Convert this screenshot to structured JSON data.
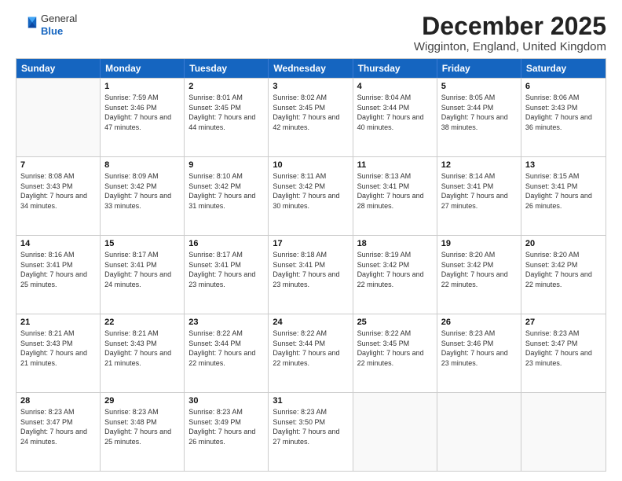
{
  "logo": {
    "line1": "General",
    "line2": "Blue"
  },
  "title": "December 2025",
  "subtitle": "Wigginton, England, United Kingdom",
  "header_days": [
    "Sunday",
    "Monday",
    "Tuesday",
    "Wednesday",
    "Thursday",
    "Friday",
    "Saturday"
  ],
  "weeks": [
    [
      {
        "day": "",
        "sunrise": "",
        "sunset": "",
        "daylight": ""
      },
      {
        "day": "1",
        "sunrise": "Sunrise: 7:59 AM",
        "sunset": "Sunset: 3:46 PM",
        "daylight": "Daylight: 7 hours and 47 minutes."
      },
      {
        "day": "2",
        "sunrise": "Sunrise: 8:01 AM",
        "sunset": "Sunset: 3:45 PM",
        "daylight": "Daylight: 7 hours and 44 minutes."
      },
      {
        "day": "3",
        "sunrise": "Sunrise: 8:02 AM",
        "sunset": "Sunset: 3:45 PM",
        "daylight": "Daylight: 7 hours and 42 minutes."
      },
      {
        "day": "4",
        "sunrise": "Sunrise: 8:04 AM",
        "sunset": "Sunset: 3:44 PM",
        "daylight": "Daylight: 7 hours and 40 minutes."
      },
      {
        "day": "5",
        "sunrise": "Sunrise: 8:05 AM",
        "sunset": "Sunset: 3:44 PM",
        "daylight": "Daylight: 7 hours and 38 minutes."
      },
      {
        "day": "6",
        "sunrise": "Sunrise: 8:06 AM",
        "sunset": "Sunset: 3:43 PM",
        "daylight": "Daylight: 7 hours and 36 minutes."
      }
    ],
    [
      {
        "day": "7",
        "sunrise": "Sunrise: 8:08 AM",
        "sunset": "Sunset: 3:43 PM",
        "daylight": "Daylight: 7 hours and 34 minutes."
      },
      {
        "day": "8",
        "sunrise": "Sunrise: 8:09 AM",
        "sunset": "Sunset: 3:42 PM",
        "daylight": "Daylight: 7 hours and 33 minutes."
      },
      {
        "day": "9",
        "sunrise": "Sunrise: 8:10 AM",
        "sunset": "Sunset: 3:42 PM",
        "daylight": "Daylight: 7 hours and 31 minutes."
      },
      {
        "day": "10",
        "sunrise": "Sunrise: 8:11 AM",
        "sunset": "Sunset: 3:42 PM",
        "daylight": "Daylight: 7 hours and 30 minutes."
      },
      {
        "day": "11",
        "sunrise": "Sunrise: 8:13 AM",
        "sunset": "Sunset: 3:41 PM",
        "daylight": "Daylight: 7 hours and 28 minutes."
      },
      {
        "day": "12",
        "sunrise": "Sunrise: 8:14 AM",
        "sunset": "Sunset: 3:41 PM",
        "daylight": "Daylight: 7 hours and 27 minutes."
      },
      {
        "day": "13",
        "sunrise": "Sunrise: 8:15 AM",
        "sunset": "Sunset: 3:41 PM",
        "daylight": "Daylight: 7 hours and 26 minutes."
      }
    ],
    [
      {
        "day": "14",
        "sunrise": "Sunrise: 8:16 AM",
        "sunset": "Sunset: 3:41 PM",
        "daylight": "Daylight: 7 hours and 25 minutes."
      },
      {
        "day": "15",
        "sunrise": "Sunrise: 8:17 AM",
        "sunset": "Sunset: 3:41 PM",
        "daylight": "Daylight: 7 hours and 24 minutes."
      },
      {
        "day": "16",
        "sunrise": "Sunrise: 8:17 AM",
        "sunset": "Sunset: 3:41 PM",
        "daylight": "Daylight: 7 hours and 23 minutes."
      },
      {
        "day": "17",
        "sunrise": "Sunrise: 8:18 AM",
        "sunset": "Sunset: 3:41 PM",
        "daylight": "Daylight: 7 hours and 23 minutes."
      },
      {
        "day": "18",
        "sunrise": "Sunrise: 8:19 AM",
        "sunset": "Sunset: 3:42 PM",
        "daylight": "Daylight: 7 hours and 22 minutes."
      },
      {
        "day": "19",
        "sunrise": "Sunrise: 8:20 AM",
        "sunset": "Sunset: 3:42 PM",
        "daylight": "Daylight: 7 hours and 22 minutes."
      },
      {
        "day": "20",
        "sunrise": "Sunrise: 8:20 AM",
        "sunset": "Sunset: 3:42 PM",
        "daylight": "Daylight: 7 hours and 22 minutes."
      }
    ],
    [
      {
        "day": "21",
        "sunrise": "Sunrise: 8:21 AM",
        "sunset": "Sunset: 3:43 PM",
        "daylight": "Daylight: 7 hours and 21 minutes."
      },
      {
        "day": "22",
        "sunrise": "Sunrise: 8:21 AM",
        "sunset": "Sunset: 3:43 PM",
        "daylight": "Daylight: 7 hours and 21 minutes."
      },
      {
        "day": "23",
        "sunrise": "Sunrise: 8:22 AM",
        "sunset": "Sunset: 3:44 PM",
        "daylight": "Daylight: 7 hours and 22 minutes."
      },
      {
        "day": "24",
        "sunrise": "Sunrise: 8:22 AM",
        "sunset": "Sunset: 3:44 PM",
        "daylight": "Daylight: 7 hours and 22 minutes."
      },
      {
        "day": "25",
        "sunrise": "Sunrise: 8:22 AM",
        "sunset": "Sunset: 3:45 PM",
        "daylight": "Daylight: 7 hours and 22 minutes."
      },
      {
        "day": "26",
        "sunrise": "Sunrise: 8:23 AM",
        "sunset": "Sunset: 3:46 PM",
        "daylight": "Daylight: 7 hours and 23 minutes."
      },
      {
        "day": "27",
        "sunrise": "Sunrise: 8:23 AM",
        "sunset": "Sunset: 3:47 PM",
        "daylight": "Daylight: 7 hours and 23 minutes."
      }
    ],
    [
      {
        "day": "28",
        "sunrise": "Sunrise: 8:23 AM",
        "sunset": "Sunset: 3:47 PM",
        "daylight": "Daylight: 7 hours and 24 minutes."
      },
      {
        "day": "29",
        "sunrise": "Sunrise: 8:23 AM",
        "sunset": "Sunset: 3:48 PM",
        "daylight": "Daylight: 7 hours and 25 minutes."
      },
      {
        "day": "30",
        "sunrise": "Sunrise: 8:23 AM",
        "sunset": "Sunset: 3:49 PM",
        "daylight": "Daylight: 7 hours and 26 minutes."
      },
      {
        "day": "31",
        "sunrise": "Sunrise: 8:23 AM",
        "sunset": "Sunset: 3:50 PM",
        "daylight": "Daylight: 7 hours and 27 minutes."
      },
      {
        "day": "",
        "sunrise": "",
        "sunset": "",
        "daylight": ""
      },
      {
        "day": "",
        "sunrise": "",
        "sunset": "",
        "daylight": ""
      },
      {
        "day": "",
        "sunrise": "",
        "sunset": "",
        "daylight": ""
      }
    ]
  ]
}
